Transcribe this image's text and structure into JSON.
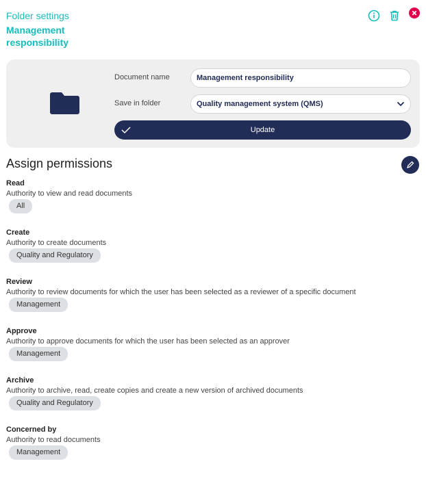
{
  "header": {
    "title": "Folder settings",
    "subtitle": "Management responsibility",
    "icons": [
      "info-icon",
      "trash-icon",
      "close-icon"
    ],
    "accent": "#17bdbd",
    "close_color": "#e0004d"
  },
  "form": {
    "name_label": "Document name",
    "name_value": "Management responsibility",
    "folder_label": "Save in folder",
    "folder_value": "Quality management system (QMS)",
    "update_label": "Update"
  },
  "permissions": {
    "title": "Assign permissions",
    "items": [
      {
        "title": "Read",
        "desc": "Authority to view and read documents",
        "chip": "All"
      },
      {
        "title": "Create",
        "desc": "Authority to create documents",
        "chip": "Quality and Regulatory"
      },
      {
        "title": "Review",
        "desc": "Authority to review documents for which the user has been selected as a reviewer of a specific document",
        "chip": "Management"
      },
      {
        "title": "Approve",
        "desc": "Authority to approve documents for which the user has been selected as an approver",
        "chip": "Management"
      },
      {
        "title": "Archive",
        "desc": "Authority to archive, read, create copies and create a new version of archived documents",
        "chip": "Quality and Regulatory"
      },
      {
        "title": "Concerned by",
        "desc": "Authority to read documents",
        "chip": "Management"
      }
    ]
  }
}
